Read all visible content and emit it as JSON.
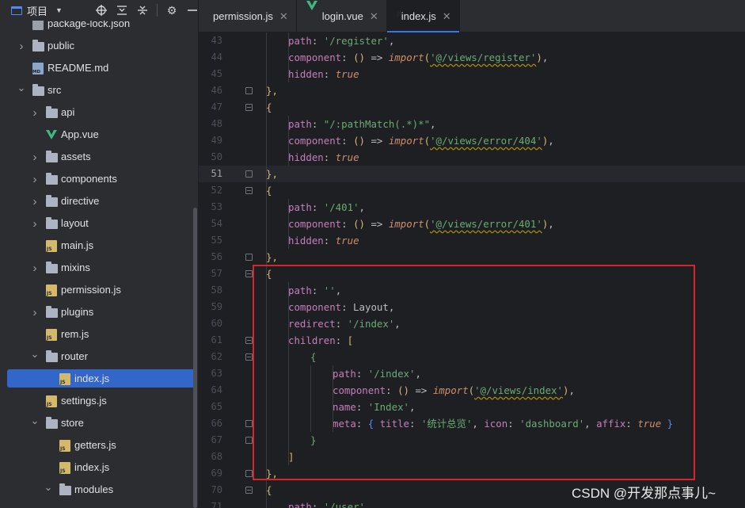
{
  "sidebar": {
    "title": "项目",
    "tree": [
      {
        "label": "package-lock.json",
        "icon": "json-file-icon",
        "indent": 40,
        "arrow": null
      },
      {
        "label": "public",
        "icon": "folder-icon",
        "indent": 40,
        "arrow": "right"
      },
      {
        "label": "README.md",
        "icon": "md-file-icon",
        "indent": 40,
        "arrow": null
      },
      {
        "label": "src",
        "icon": "folder-icon",
        "indent": 40,
        "arrow": "down"
      },
      {
        "label": "api",
        "icon": "folder-icon",
        "indent": 57,
        "arrow": "right"
      },
      {
        "label": "App.vue",
        "icon": "vue-file-icon",
        "indent": 57,
        "arrow": null
      },
      {
        "label": "assets",
        "icon": "folder-icon",
        "indent": 57,
        "arrow": "right"
      },
      {
        "label": "components",
        "icon": "folder-icon",
        "indent": 57,
        "arrow": "right"
      },
      {
        "label": "directive",
        "icon": "folder-icon",
        "indent": 57,
        "arrow": "right"
      },
      {
        "label": "layout",
        "icon": "folder-icon",
        "indent": 57,
        "arrow": "right"
      },
      {
        "label": "main.js",
        "icon": "js-file-icon",
        "indent": 57,
        "arrow": null
      },
      {
        "label": "mixins",
        "icon": "folder-icon",
        "indent": 57,
        "arrow": "right"
      },
      {
        "label": "permission.js",
        "icon": "js-file-icon",
        "indent": 57,
        "arrow": null
      },
      {
        "label": "plugins",
        "icon": "folder-icon",
        "indent": 57,
        "arrow": "right"
      },
      {
        "label": "rem.js",
        "icon": "js-file-icon",
        "indent": 57,
        "arrow": null
      },
      {
        "label": "router",
        "icon": "folder-icon",
        "indent": 57,
        "arrow": "down"
      },
      {
        "label": "index.js",
        "icon": "js-file-icon",
        "indent": 74,
        "arrow": null,
        "selected": true
      },
      {
        "label": "settings.js",
        "icon": "js-file-icon",
        "indent": 57,
        "arrow": null
      },
      {
        "label": "store",
        "icon": "folder-icon",
        "indent": 57,
        "arrow": "down"
      },
      {
        "label": "getters.js",
        "icon": "js-file-icon",
        "indent": 74,
        "arrow": null
      },
      {
        "label": "index.js",
        "icon": "js-file-icon",
        "indent": 74,
        "arrow": null
      },
      {
        "label": "modules",
        "icon": "folder-icon",
        "indent": 74,
        "arrow": "down"
      }
    ]
  },
  "tabs": [
    {
      "label": "permission.js",
      "icon": "js-file-icon",
      "active": false
    },
    {
      "label": "login.vue",
      "icon": "vue-file-icon",
      "active": false
    },
    {
      "label": "index.js",
      "icon": "js-file-icon",
      "active": true
    }
  ],
  "editor": {
    "first_line": 43,
    "current_line": 51,
    "lines": [
      [
        [
          "p",
          "path"
        ],
        [
          "b",
          ": "
        ],
        [
          "s",
          "'/register'"
        ],
        [
          "b",
          ","
        ]
      ],
      [
        [
          "p",
          "component"
        ],
        [
          "b",
          ": "
        ],
        [
          "y",
          "()"
        ],
        [
          "b",
          " => "
        ],
        [
          "it",
          "import"
        ],
        [
          "y",
          "("
        ],
        [
          "su",
          "'@/views/register'"
        ],
        [
          "y",
          ")"
        ],
        [
          "b",
          ","
        ]
      ],
      [
        [
          "p",
          "hidden"
        ],
        [
          "b",
          ": "
        ],
        [
          "tr",
          "true"
        ]
      ],
      [
        [
          "y",
          "},"
        ]
      ],
      [
        [
          "y",
          "{"
        ]
      ],
      [
        [
          "p",
          "path"
        ],
        [
          "b",
          ": "
        ],
        [
          "s",
          "\"/:pathMatch(.*)*\""
        ],
        [
          "b",
          ","
        ]
      ],
      [
        [
          "p",
          "component"
        ],
        [
          "b",
          ": "
        ],
        [
          "y",
          "()"
        ],
        [
          "b",
          " => "
        ],
        [
          "it",
          "import"
        ],
        [
          "y",
          "("
        ],
        [
          "su",
          "'@/views/error/404'"
        ],
        [
          "y",
          ")"
        ],
        [
          "b",
          ","
        ]
      ],
      [
        [
          "p",
          "hidden"
        ],
        [
          "b",
          ": "
        ],
        [
          "tr",
          "true"
        ]
      ],
      [
        [
          "y",
          "},"
        ]
      ],
      [
        [
          "y",
          "{"
        ]
      ],
      [
        [
          "p",
          "path"
        ],
        [
          "b",
          ": "
        ],
        [
          "s",
          "'/401'"
        ],
        [
          "b",
          ","
        ]
      ],
      [
        [
          "p",
          "component"
        ],
        [
          "b",
          ": "
        ],
        [
          "y",
          "()"
        ],
        [
          "b",
          " => "
        ],
        [
          "it",
          "import"
        ],
        [
          "y",
          "("
        ],
        [
          "su",
          "'@/views/error/401'"
        ],
        [
          "y",
          ")"
        ],
        [
          "b",
          ","
        ]
      ],
      [
        [
          "p",
          "hidden"
        ],
        [
          "b",
          ": "
        ],
        [
          "tr",
          "true"
        ]
      ],
      [
        [
          "y",
          "},"
        ]
      ],
      [
        [
          "y",
          "{"
        ]
      ],
      [
        [
          "p",
          "path"
        ],
        [
          "b",
          ": "
        ],
        [
          "s",
          "''"
        ],
        [
          "b",
          ","
        ]
      ],
      [
        [
          "p",
          "component"
        ],
        [
          "b",
          ": Layout,"
        ]
      ],
      [
        [
          "p",
          "redirect"
        ],
        [
          "b",
          ": "
        ],
        [
          "s",
          "'/index'"
        ],
        [
          "b",
          ","
        ]
      ],
      [
        [
          "p",
          "children"
        ],
        [
          "b",
          ": "
        ],
        [
          "y",
          "["
        ]
      ],
      [
        [
          "g",
          "{"
        ]
      ],
      [
        [
          "p",
          "path"
        ],
        [
          "b",
          ": "
        ],
        [
          "s",
          "'/index'"
        ],
        [
          "b",
          ","
        ]
      ],
      [
        [
          "p",
          "component"
        ],
        [
          "b",
          ": "
        ],
        [
          "y",
          "()"
        ],
        [
          "b",
          " => "
        ],
        [
          "it",
          "import"
        ],
        [
          "y",
          "("
        ],
        [
          "su",
          "'@/views/index'"
        ],
        [
          "y",
          ")"
        ],
        [
          "b",
          ","
        ]
      ],
      [
        [
          "p",
          "name"
        ],
        [
          "b",
          ": "
        ],
        [
          "s",
          "'Index'"
        ],
        [
          "b",
          ","
        ]
      ],
      [
        [
          "p",
          "meta"
        ],
        [
          "b",
          ": "
        ],
        [
          "bl",
          "{"
        ],
        [
          "b",
          " "
        ],
        [
          "p",
          "title"
        ],
        [
          "b",
          ": "
        ],
        [
          "s",
          "'统计总览'"
        ],
        [
          "b",
          ", "
        ],
        [
          "p",
          "icon"
        ],
        [
          "b",
          ": "
        ],
        [
          "s",
          "'dashboard'"
        ],
        [
          "b",
          ", "
        ],
        [
          "p",
          "affix"
        ],
        [
          "b",
          ": "
        ],
        [
          "tr",
          "true"
        ],
        [
          "b",
          " "
        ],
        [
          "bl",
          "}"
        ]
      ],
      [
        [
          "g",
          "}"
        ]
      ],
      [
        [
          "y",
          "]"
        ]
      ],
      [
        [
          "y",
          "},"
        ]
      ],
      [
        [
          "y",
          "{"
        ]
      ],
      [
        [
          "p",
          "path"
        ],
        [
          "b",
          ": "
        ],
        [
          "s",
          "'/user'"
        ],
        [
          "b",
          ","
        ]
      ]
    ],
    "indents": [
      0,
      0,
      0,
      -1,
      -1,
      0,
      0,
      0,
      -1,
      -1,
      0,
      0,
      0,
      -1,
      -1,
      0,
      0,
      0,
      0,
      1,
      2,
      2,
      2,
      2,
      1,
      0,
      -1,
      -1,
      0
    ],
    "folds": {
      "46": "close",
      "47": "open",
      "51": "close",
      "52": "open",
      "56": "close",
      "57": "open",
      "61": "open",
      "62": "open",
      "66": "close",
      "67": "close",
      "69": "close",
      "70": "open"
    }
  },
  "watermark": "CSDN @开发那点事儿~",
  "colors": {
    "accent": "#3574f0",
    "highlight_box": "#d4262b"
  }
}
